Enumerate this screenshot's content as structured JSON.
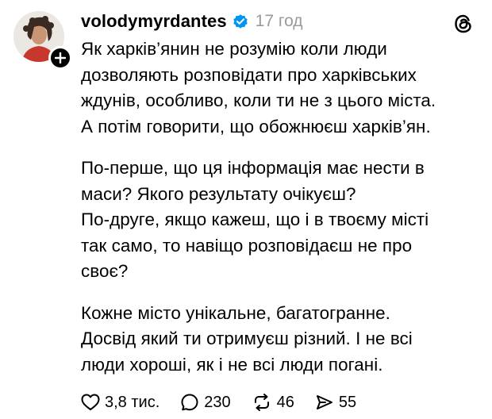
{
  "post": {
    "username": "volodymyrdantes",
    "time": "17 год",
    "paragraphs": [
      "Як харків’янин не розумію коли люди\nдозволяють розповідати про харківських\nждунів, особливо, коли ти не з цього міста.\nА потім говорити, що обожнюєш харків’ян.",
      "По-перше, що ця інформація має нести в\nмаси? Якого результату очікуєш?",
      "По-друге, якщо кажеш, що і в твоєму місті\nтак само, то навіщо розповідаєш не про\nсвоє?",
      "Кожне місто унікальне, багатогранне.\nДосвід який ти отримуєш різний. І не всі\nлюди хороші, як і не всі люди погані."
    ]
  },
  "actions": {
    "likes": "3,8 тис.",
    "replies": "230",
    "reposts": "46",
    "shares": "55"
  },
  "colors": {
    "verified": "#0095f6",
    "muted": "#9a9a9a"
  },
  "icons": [
    "avatar",
    "follow-plus-icon",
    "verified-badge-icon",
    "threads-logo-icon",
    "heart-icon",
    "comment-icon",
    "repost-icon",
    "share-icon"
  ]
}
